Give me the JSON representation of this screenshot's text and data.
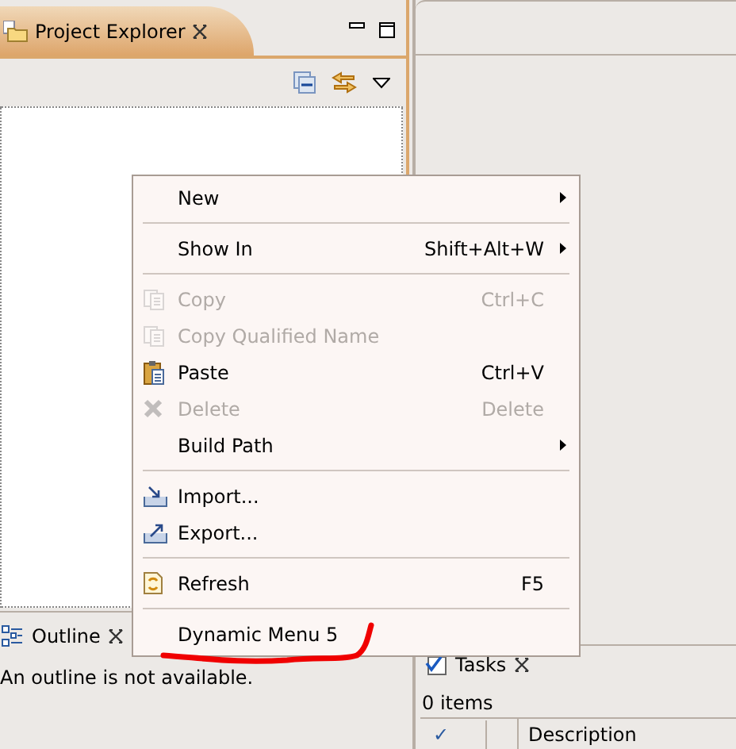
{
  "project_explorer": {
    "title": "Project Explorer"
  },
  "outline": {
    "title": "Outline",
    "message": "An outline is not available."
  },
  "tasks": {
    "title": "Tasks",
    "summary": "0 items",
    "columns": [
      "✓",
      "Description"
    ]
  },
  "context_menu": {
    "items": [
      {
        "kind": "item",
        "label": "New",
        "submenu": true,
        "disabled": false
      },
      {
        "kind": "separator"
      },
      {
        "kind": "item",
        "label": "Show In",
        "shortcut": "Shift+Alt+W",
        "submenu": true,
        "disabled": false
      },
      {
        "kind": "separator"
      },
      {
        "kind": "item",
        "label": "Copy",
        "shortcut": "Ctrl+C",
        "submenu": false,
        "disabled": true
      },
      {
        "kind": "item",
        "label": "Copy Qualified Name",
        "submenu": false,
        "disabled": true
      },
      {
        "kind": "item",
        "label": "Paste",
        "shortcut": "Ctrl+V",
        "submenu": false,
        "disabled": false
      },
      {
        "kind": "item",
        "label": "Delete",
        "shortcut": "Delete",
        "submenu": false,
        "disabled": true
      },
      {
        "kind": "item",
        "label": "Build Path",
        "submenu": true,
        "disabled": false
      },
      {
        "kind": "separator"
      },
      {
        "kind": "item",
        "label": "Import...",
        "submenu": false,
        "disabled": false
      },
      {
        "kind": "item",
        "label": "Export...",
        "submenu": false,
        "disabled": false
      },
      {
        "kind": "separator"
      },
      {
        "kind": "item",
        "label": "Refresh",
        "shortcut": "F5",
        "submenu": false,
        "disabled": false
      },
      {
        "kind": "separator"
      },
      {
        "kind": "item",
        "label": "Dynamic Menu 5",
        "submenu": false,
        "disabled": false
      }
    ]
  }
}
